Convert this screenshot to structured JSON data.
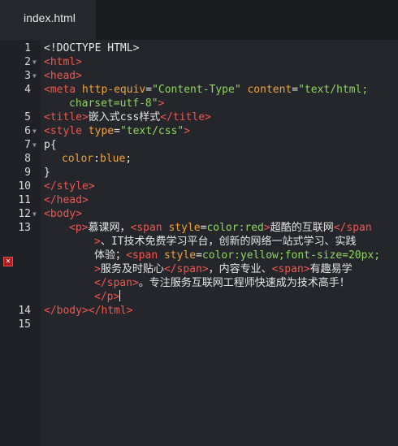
{
  "tab": {
    "title": "index.html"
  },
  "gutter": {
    "line_numbers": [
      "1",
      "2",
      "3",
      "4",
      "5",
      "6",
      "7",
      "8",
      "9",
      "10",
      "11",
      "12",
      "13",
      "14",
      "15"
    ]
  },
  "code": {
    "l1": "<!DOCTYPE HTML>",
    "l2": "<html>",
    "l3": "<head>",
    "l4a_tag": "<meta ",
    "l4a_attr1": "http-equiv",
    "l4a_eq1": "=",
    "l4a_val1": "\"Content-Type\"",
    "l4a_attr2": " content",
    "l4a_eq2": "=",
    "l4a_val2": "\"text/html;",
    "l4b_val": "charset=utf-8\"",
    "l4b_tag": ">",
    "l5_open": "<title>",
    "l5_text": "嵌入式css样式",
    "l5_close": "</title>",
    "l6_tag": "<style ",
    "l6_attr": "type",
    "l6_eq": "=",
    "l6_val": "\"text/css\"",
    "l6_end": ">",
    "l7": "p{",
    "l8_prop": "color",
    "l8_colon": ":",
    "l8_val": "blue",
    "l8_semi": ";",
    "l9": "}",
    "l10": "</style>",
    "l11": "</head>",
    "l12": "<body>",
    "l13a_p": "<p>",
    "l13a_text": "慕课网，",
    "l13a_span": "<span ",
    "l13a_attr": "style",
    "l13a_eq": "=",
    "l13a_val": "color:red",
    "l13a_gt": ">",
    "l13a_text2": "超酷的互联网",
    "l13a_close": "</span",
    "l13b_gt": ">",
    "l13b_text": "、IT技术免费学习平台，创新的网络一站式学习、实践",
    "l13c_text": "体验；",
    "l13c_span": "<span ",
    "l13c_attr": "style",
    "l13c_eq": "=",
    "l13c_val": "color:yellow;font-size=20px;",
    "l13d_gt": ">",
    "l13d_text": "服务及时贴心",
    "l13d_close": "</span>",
    "l13d_text2": "，内容专业、",
    "l13d_span": "<span>",
    "l13d_text3": "有趣易学",
    "l13e_close": "</span>",
    "l13e_text": "。专注服务互联网工程师快速成为技术高手！",
    "l13f_close": "</p>",
    "l14": "</body></html>",
    "l15": ""
  },
  "markers": {
    "error_icon": "error-icon"
  }
}
